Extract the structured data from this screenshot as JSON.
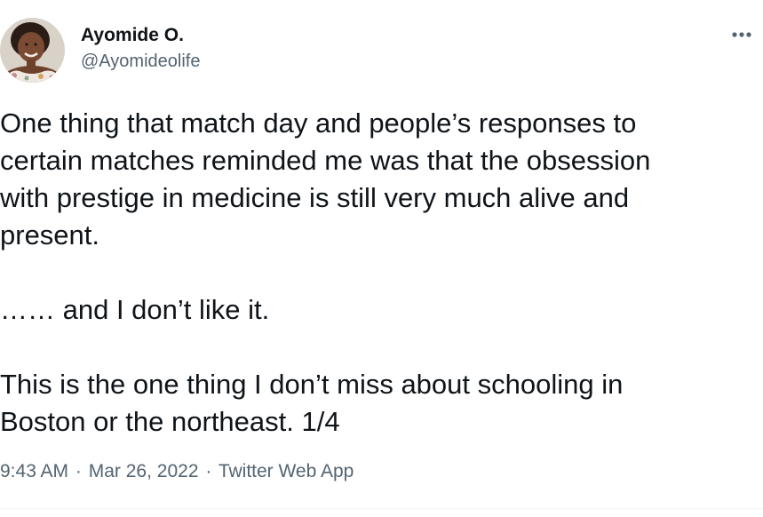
{
  "author": {
    "display_name": "Ayomide O.",
    "handle": "@Ayomideolife"
  },
  "more_icon": "more-horizontal-icon",
  "tweet": {
    "paragraph1": [
      "One thing that match day and people’s responses to",
      "certain matches reminded me was that the obsession",
      "with prestige in medicine is still very much alive and",
      "present."
    ],
    "paragraph2": "…… and I don’t like it.",
    "paragraph3": [
      "This is the one thing I don’t miss about schooling in",
      "Boston or the northeast. 1/4"
    ]
  },
  "meta": {
    "time": "9:43 AM",
    "date": "Mar 26, 2022",
    "source": "Twitter Web App",
    "separator": "·"
  },
  "colors": {
    "text": "#0f1419",
    "secondary": "#536471"
  }
}
